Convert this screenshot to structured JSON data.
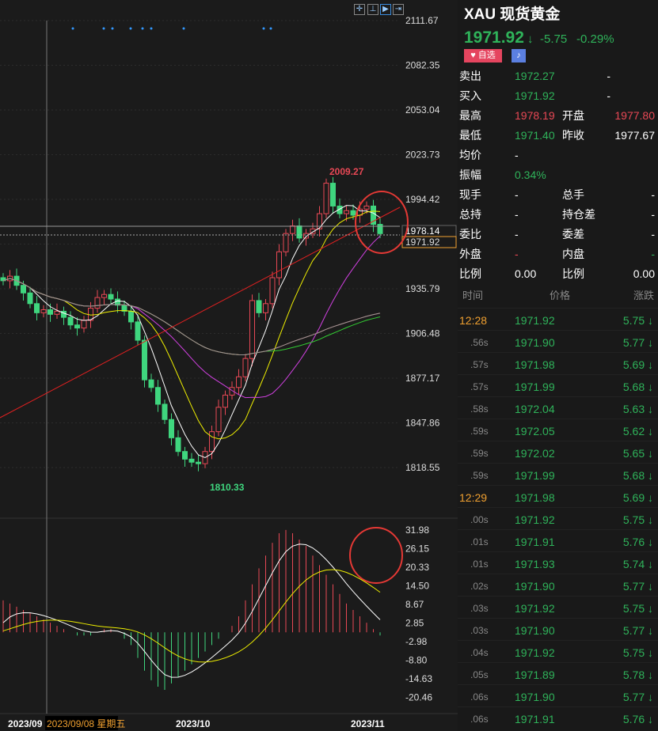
{
  "header": {
    "symbol": "XAU",
    "name": "现货黄金",
    "price": "1971.92",
    "change": "-5.75",
    "change_pct": "-0.29%",
    "fav_label": "自选",
    "arrow": "down-arrow-icon"
  },
  "quote": [
    {
      "l": "卖出",
      "v": "1972.27",
      "c": "g",
      "l2": "",
      "v2": "-"
    },
    {
      "l": "买入",
      "v": "1971.92",
      "c": "g",
      "l2": "",
      "v2": "-"
    },
    {
      "l": "最高",
      "v": "1978.19",
      "c": "r",
      "l2": "开盘",
      "v2": "1977.80",
      "c2": "r"
    },
    {
      "l": "最低",
      "v": "1971.40",
      "c": "g",
      "l2": "昨收",
      "v2": "1977.67",
      "c2": "w"
    },
    {
      "l": "均价",
      "v": "-",
      "c": "w",
      "l2": "",
      "v2": ""
    },
    {
      "l": "振幅",
      "v": "0.34%",
      "c": "g",
      "l2": "",
      "v2": ""
    },
    {
      "l": "现手",
      "v": "-",
      "c": "w",
      "l2": "总手",
      "v2": "-"
    },
    {
      "l": "总持",
      "v": "-",
      "c": "w",
      "l2": "持仓差",
      "v2": "-"
    },
    {
      "l": "委比",
      "v": "-",
      "c": "w",
      "l2": "委差",
      "v2": "-"
    },
    {
      "l": "外盘",
      "v": "-",
      "c": "r",
      "l2": "内盘",
      "v2": "-",
      "c2": "g"
    },
    {
      "l": "比例",
      "v": "0.00",
      "c": "w",
      "l2": "比例",
      "v2": "0.00"
    }
  ],
  "ticks_header": {
    "time": "时间",
    "price": "价格",
    "change": "涨跌"
  },
  "ticks": [
    {
      "t": "12:28",
      "p": "1971.92",
      "c": "5.75"
    },
    {
      "t": ".56s",
      "p": "1971.90",
      "c": "5.77"
    },
    {
      "t": ".57s",
      "p": "1971.98",
      "c": "5.69"
    },
    {
      "t": ".57s",
      "p": "1971.99",
      "c": "5.68"
    },
    {
      "t": ".58s",
      "p": "1972.04",
      "c": "5.63"
    },
    {
      "t": ".59s",
      "p": "1972.05",
      "c": "5.62"
    },
    {
      "t": ".59s",
      "p": "1972.02",
      "c": "5.65"
    },
    {
      "t": ".59s",
      "p": "1971.99",
      "c": "5.68"
    },
    {
      "t": "12:29",
      "p": "1971.98",
      "c": "5.69"
    },
    {
      "t": ".00s",
      "p": "1971.92",
      "c": "5.75"
    },
    {
      "t": ".01s",
      "p": "1971.91",
      "c": "5.76"
    },
    {
      "t": ".01s",
      "p": "1971.93",
      "c": "5.74"
    },
    {
      "t": ".02s",
      "p": "1971.90",
      "c": "5.77"
    },
    {
      "t": ".03s",
      "p": "1971.92",
      "c": "5.75"
    },
    {
      "t": ".03s",
      "p": "1971.90",
      "c": "5.77"
    },
    {
      "t": ".04s",
      "p": "1971.92",
      "c": "5.75"
    },
    {
      "t": ".05s",
      "p": "1971.89",
      "c": "5.78"
    },
    {
      "t": ".06s",
      "p": "1971.90",
      "c": "5.77"
    },
    {
      "t": ".06s",
      "p": "1971.91",
      "c": "5.76"
    }
  ],
  "chart_data": {
    "type": "candlestick",
    "price_axis": [
      "2111.67",
      "2082.35",
      "2053.04",
      "2023.73",
      "1994.42",
      "1965.11",
      "1935.79",
      "1906.48",
      "1877.17",
      "1847.86",
      "1818.55"
    ],
    "price_range": [
      1805,
      2120
    ],
    "current_label": "1978.14",
    "last_label": "1971.92",
    "high_label": "2009.27",
    "low_label": "1810.33",
    "closes": [
      1941,
      1944,
      1938,
      1933,
      1926,
      1920,
      1922,
      1919,
      1921,
      1917,
      1912,
      1910,
      1915,
      1923,
      1930,
      1932,
      1929,
      1925,
      1921,
      1914,
      1902,
      1876,
      1871,
      1860,
      1850,
      1838,
      1829,
      1824,
      1822,
      1821,
      1829,
      1842,
      1858,
      1866,
      1871,
      1878,
      1890,
      1928,
      1920,
      1926,
      1943,
      1960,
      1972,
      1977,
      1969,
      1972,
      1975,
      1985,
      2005,
      1990,
      1985,
      1987,
      1984,
      1988,
      1990,
      1978,
      1971.92
    ],
    "macd_axis": [
      "31.98",
      "26.15",
      "20.33",
      "14.50",
      "8.67",
      "2.85",
      "-2.98",
      "-8.80",
      "-14.63",
      "-20.46"
    ],
    "macd_range": [
      -24,
      34
    ],
    "macd_hist": [
      10,
      9,
      8,
      7,
      6,
      5,
      4,
      3,
      2,
      1,
      0,
      -1,
      -1,
      -1,
      0,
      1,
      1,
      0,
      -2,
      -4,
      -8,
      -12,
      -15,
      -17,
      -18,
      -16,
      -14,
      -12,
      -10,
      -8,
      -6,
      -4,
      -2,
      0,
      2,
      5,
      10,
      15,
      20,
      24,
      28,
      31,
      32,
      31,
      29,
      27,
      24,
      21,
      18,
      15,
      12,
      9,
      7,
      5,
      3,
      1,
      -1
    ],
    "x_labels": [
      "2023/09",
      "2023/10",
      "2023/11"
    ],
    "crosshair_label": "2023/09/08 星期五"
  }
}
